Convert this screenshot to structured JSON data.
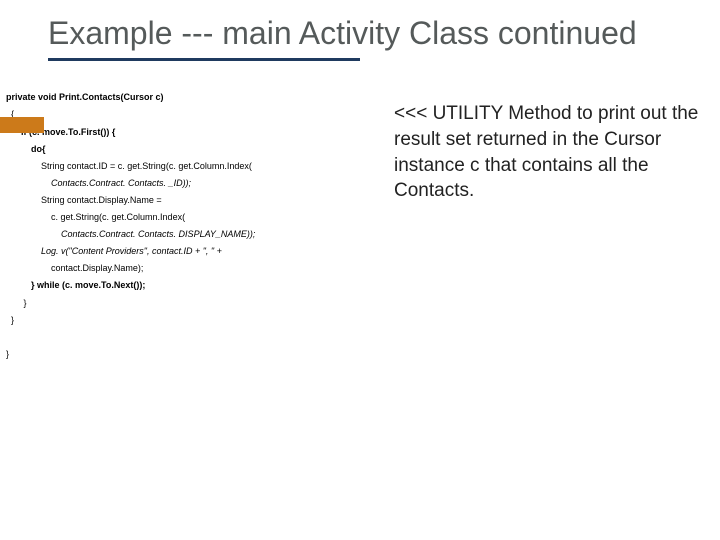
{
  "title": "Example --- main Activity Class continued",
  "code": {
    "l1": "private void Print.Contacts(Cursor c)",
    "l2": "  {",
    "l3": "      if (c. move.To.First()) {",
    "l4": "          do{",
    "l5": "              String contact.ID = c. get.String(c. get.Column.Index(",
    "l6": "                  Contacts.Contract. Contacts. _ID));",
    "l7": "              String contact.Display.Name =",
    "l8": "                  c. get.String(c. get.Column.Index(",
    "l9": "                      Contacts.Contract. Contacts. DISPLAY_NAME));",
    "l10": "              Log. v(\"Content Providers\", contact.ID + \", \" +",
    "l11": "                  contact.Display.Name);",
    "l12": "          } while (c. move.To.Next());",
    "l13": "       }",
    "l14": "  }",
    "l15": " ",
    "l16": "}"
  },
  "annotation": "<<< UTILITY Method to print out the result set returned in the Cursor instance c that contains all the Contacts."
}
